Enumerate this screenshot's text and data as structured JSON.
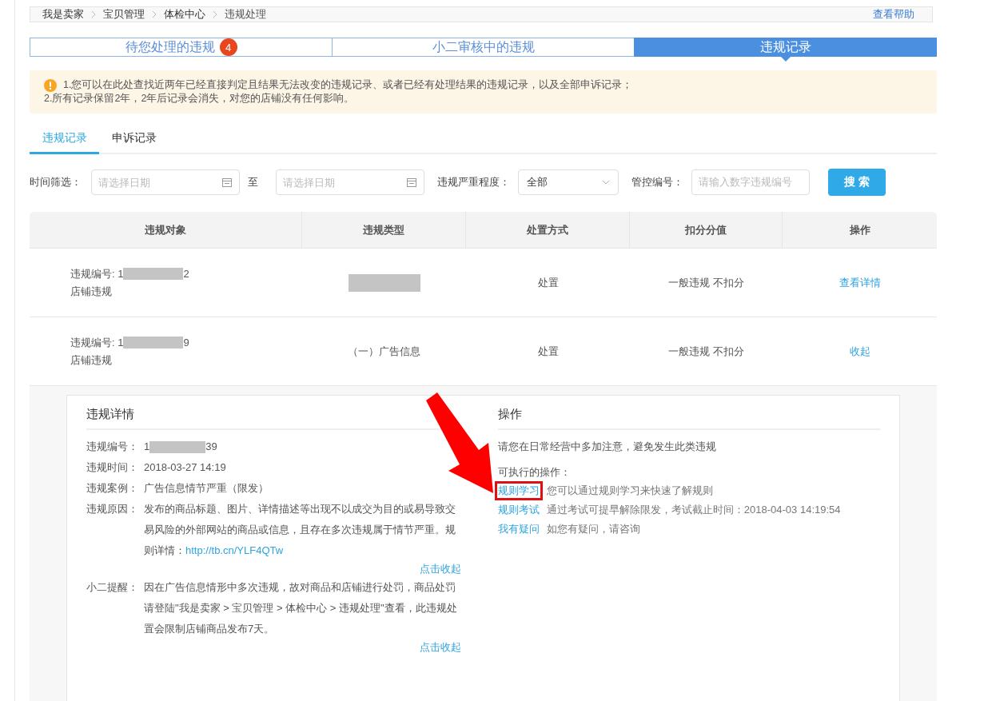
{
  "breadcrumb": {
    "items": [
      "我是卖家",
      "宝贝管理",
      "体检中心",
      "违规处理"
    ],
    "help_link": "查看帮助"
  },
  "tabs": [
    {
      "label": "待您处理的违规",
      "badge": "4",
      "selected": false
    },
    {
      "label": "小二审核中的违规",
      "selected": false
    },
    {
      "label": "违规记录",
      "selected": true
    }
  ],
  "notice": {
    "lines": [
      "1.您可以在此处查找近两年已经直接判定且结果无法改变的违规记录、或者已经有处理结果的违规记录，以及全部申诉记录；",
      "2.所有记录保留2年，2年后记录会消失，对您的店铺没有任何影响。"
    ]
  },
  "sub_tabs": [
    {
      "label": "违规记录",
      "selected": true
    },
    {
      "label": "申诉记录",
      "selected": false
    }
  ],
  "filters": {
    "time_label": "时间筛选：",
    "start_date": {
      "placeholder": "请选择日期"
    },
    "separator": "至",
    "end_date": {
      "placeholder": "请选择日期"
    },
    "severity_label": "违规严重程度：",
    "severity": {
      "value": "全部"
    },
    "control_label": "管控编号：",
    "control_id": {
      "placeholder": "请输入数字违规编号"
    },
    "search_button": "搜 索"
  },
  "table": {
    "columns": [
      "违规对象",
      "违规类型",
      "处置方式",
      "扣分分值",
      "操作"
    ],
    "rows": [
      {
        "id_label": "违规编号: ",
        "id_prefix": "1",
        "id_suffix": "2",
        "scope": "店铺违规",
        "type_redacted": true,
        "measure": "处置",
        "points": "一般违规 不扣分",
        "action": "查看详情",
        "expanded": false
      },
      {
        "id_label": "违规编号: ",
        "id_prefix": "1",
        "id_suffix": "9",
        "scope": "店铺违规",
        "type": "（一）广告信息",
        "type_redacted": false,
        "measure": "处置",
        "points": "一般违规 不扣分",
        "action": "收起",
        "expanded": true
      }
    ]
  },
  "detail": {
    "title": "违规详情",
    "fields": [
      {
        "label": "违规编号：",
        "id_prefix": "1",
        "id_suffix": "39",
        "kind": "redacted"
      },
      {
        "label": "违规时间：",
        "value": "2018-03-27 14:19",
        "kind": "text"
      },
      {
        "label": "违规案例：",
        "value": "广告信息情节严重（限发）",
        "kind": "text"
      },
      {
        "label": "违规原因：",
        "value": "发布的商品标题、图片、详情描述等出现不以成交为目的或易导致交易风险的外部网站的商品或信息，且存在多次违规属于情节严重。规则详情：",
        "link": "http://tb.cn/YLF4QTw",
        "kind": "link",
        "collapse": "点击收起"
      },
      {
        "label": "小二提醒：",
        "value": "因在广告信息情形中多次违规，故对商品和店铺进行处罚，商品处罚请登陆\"我是卖家 > 宝贝管理 > 体检中心 > 违规处理\"查看，此违规处置会限制店铺商品发布7天。",
        "kind": "text",
        "collapse": "点击收起"
      }
    ]
  },
  "operations": {
    "title": "操作",
    "advice": "请您在日常经营中多加注意，避免发生此类违规",
    "available_label": "可执行的操作：",
    "actions": [
      {
        "link": "规则学习",
        "text": "您可以通过规则学习来快速了解规则",
        "highlighted": true
      },
      {
        "link": "规则考试",
        "text": "通过考试可提早解除限发，考试截止时间：2018-04-03 14:19:54",
        "highlighted": false
      },
      {
        "link": "我有疑问",
        "text": "如您有疑问，请咨询",
        "highlighted": false
      }
    ]
  }
}
